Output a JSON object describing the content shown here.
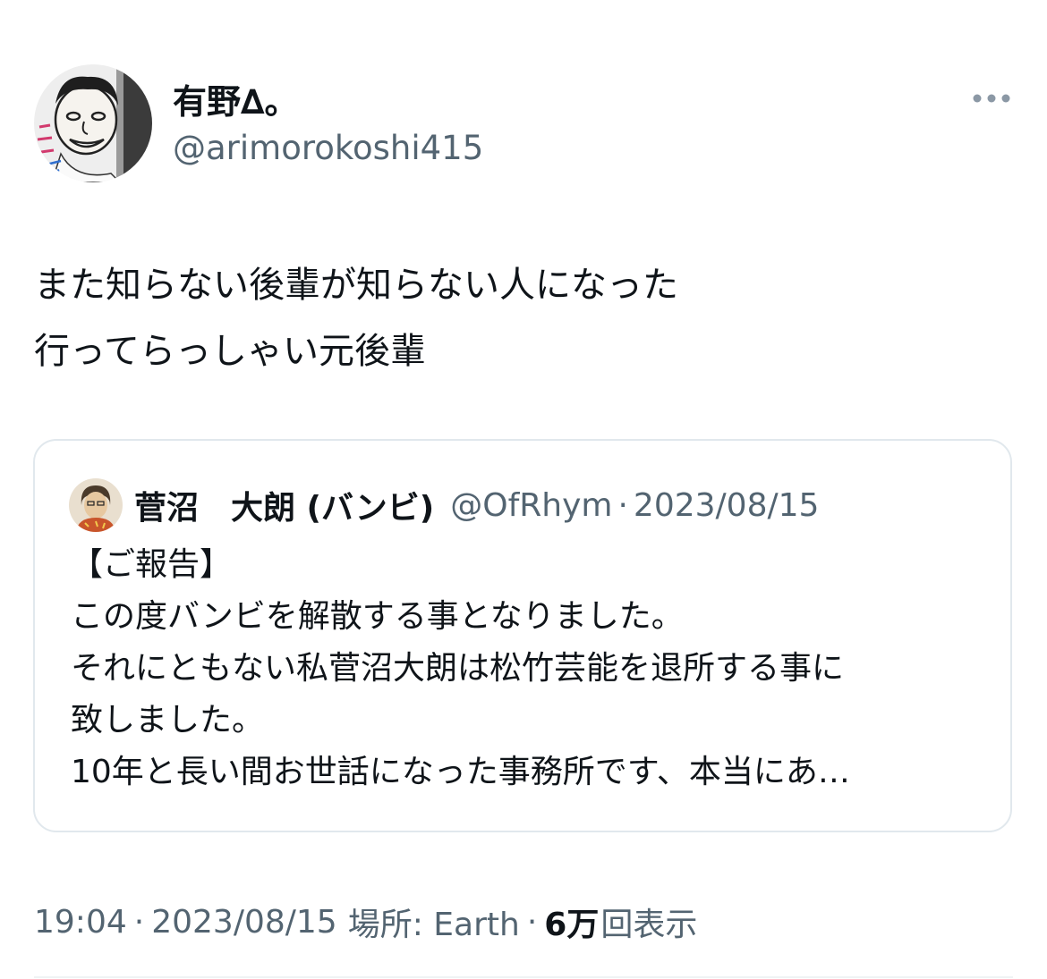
{
  "author": {
    "name": "有野∆。",
    "handle": "@arimorokoshi415",
    "avatar_icon": "user-avatar-caricature"
  },
  "more_icon": "more-horizontal-icon",
  "tweet": {
    "lines": [
      "また知らない後輩が知らない人になった",
      "行ってらっしゃい元後輩"
    ]
  },
  "quote": {
    "name": "菅沼　大朗 (バンビ)",
    "handle": "@OfRhym",
    "separator": "·",
    "date": "2023/08/15",
    "lines": [
      "【ご報告】",
      "この度バンビを解散する事となりました。",
      "それにともない私菅沼大朗は松竹芸能を退所する事に",
      "致しました。",
      "10年と長い間お世話になった事務所です、本当にあ…"
    ]
  },
  "meta": {
    "time": "19:04",
    "separator": "·",
    "date": "2023/08/15",
    "location": "場所: Earth",
    "views_count": "6万",
    "views_label": "回表示"
  },
  "colors": {
    "text": "#0f1419",
    "secondary": "#536471",
    "border": "#e1e8ed"
  }
}
